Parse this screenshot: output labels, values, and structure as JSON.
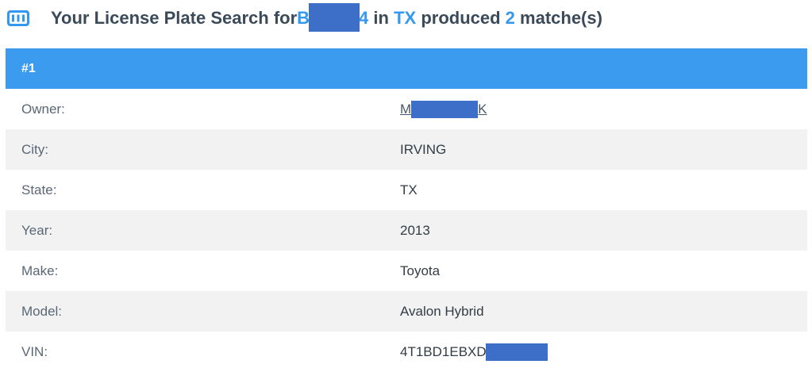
{
  "heading": {
    "prefix": "Your License Plate Search for ",
    "plate_start": "B",
    "plate_end": "4",
    "in_word": " in ",
    "state": "TX",
    "produced_word": " produced ",
    "count": "2",
    "suffix": " matche(s)"
  },
  "colors": {
    "accent": "#3a9bef",
    "redaction": "#3d6fc9",
    "stripe": "#f2f2f2"
  },
  "result": {
    "header": "#1",
    "owner_label": "Owner:",
    "owner_start": "M",
    "owner_end": "K",
    "city_label": "City:",
    "city": "IRVING",
    "state_label": "State:",
    "state": "TX",
    "year_label": "Year:",
    "year": "2013",
    "make_label": "Make:",
    "make": "Toyota",
    "model_label": "Model:",
    "model": "Avalon Hybrid",
    "vin_label": "VIN:",
    "vin_start": "4T1BD1EBXD"
  },
  "icons": {
    "heading_icon": "license-plate-icon"
  }
}
